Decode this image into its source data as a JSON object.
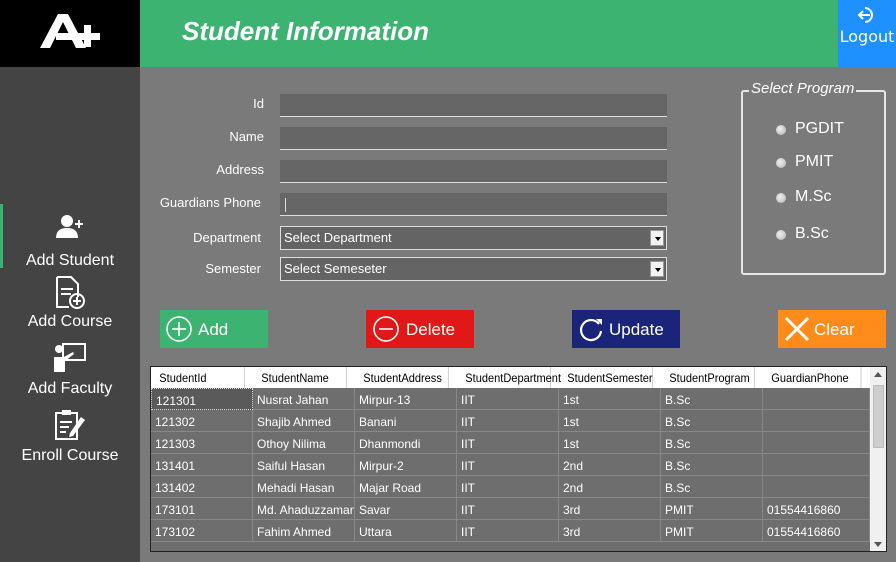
{
  "header": {
    "title": "Student Information",
    "logout_label": "Logout"
  },
  "colors": {
    "header": "#3cb371",
    "logout": "#1e90ff",
    "sidebar": "#444444",
    "body": "#7a7a7a",
    "add": "#3cb371",
    "delete": "#e01818",
    "update": "#1a2478",
    "clear": "#ff8c1a"
  },
  "sidebar": {
    "items": [
      {
        "label": "Add Student",
        "icon": "add-user-icon"
      },
      {
        "label": "Add Course",
        "icon": "add-file-icon"
      },
      {
        "label": "Add Faculty",
        "icon": "teacher-board-icon"
      },
      {
        "label": "Enroll Course",
        "icon": "clipboard-pen-icon"
      }
    ]
  },
  "form": {
    "id_label": "Id",
    "name_label": "Name",
    "address_label": "Address",
    "phone_label": "Guardians Phone",
    "department_label": "Department",
    "department_value": "Select Department",
    "semester_label": "Semester",
    "semester_value": "Select Semeseter"
  },
  "program": {
    "legend": "Select Program",
    "options": [
      "PGDIT",
      "PMIT",
      "M.Sc",
      "B.Sc"
    ]
  },
  "buttons": {
    "add": "Add",
    "delete": "Delete",
    "update": "Update",
    "clear": "Clear"
  },
  "table": {
    "columns": [
      "StudentId",
      "StudentName",
      "StudentAddress",
      "StudentDepartment",
      "StudentSemester",
      "StudentProgram",
      "GuardianPhone"
    ],
    "rows": [
      [
        "121301",
        "Nusrat Jahan",
        "Mirpur-13",
        "IIT",
        "1st",
        "B.Sc",
        ""
      ],
      [
        "121302",
        "Shajib Ahmed",
        "Banani",
        "IIT",
        "1st",
        "B.Sc",
        ""
      ],
      [
        "121303",
        "Othoy Nilima",
        "Dhanmondi",
        "IIT",
        "1st",
        "B.Sc",
        ""
      ],
      [
        "131401",
        "Saiful Hasan",
        "Mirpur-2",
        "IIT",
        "2nd",
        "B.Sc",
        ""
      ],
      [
        "131402",
        "Mehadi Hasan",
        "Majar Road",
        "IIT",
        "2nd",
        "B.Sc",
        ""
      ],
      [
        "173101",
        "Md. Ahaduzzaman",
        "Savar",
        "IIT",
        "3rd",
        "PMIT",
        "01554416860"
      ],
      [
        "173102",
        "Fahim Ahmed",
        "Uttara",
        "IIT",
        "3rd",
        "PMIT",
        "01554416860"
      ]
    ]
  }
}
